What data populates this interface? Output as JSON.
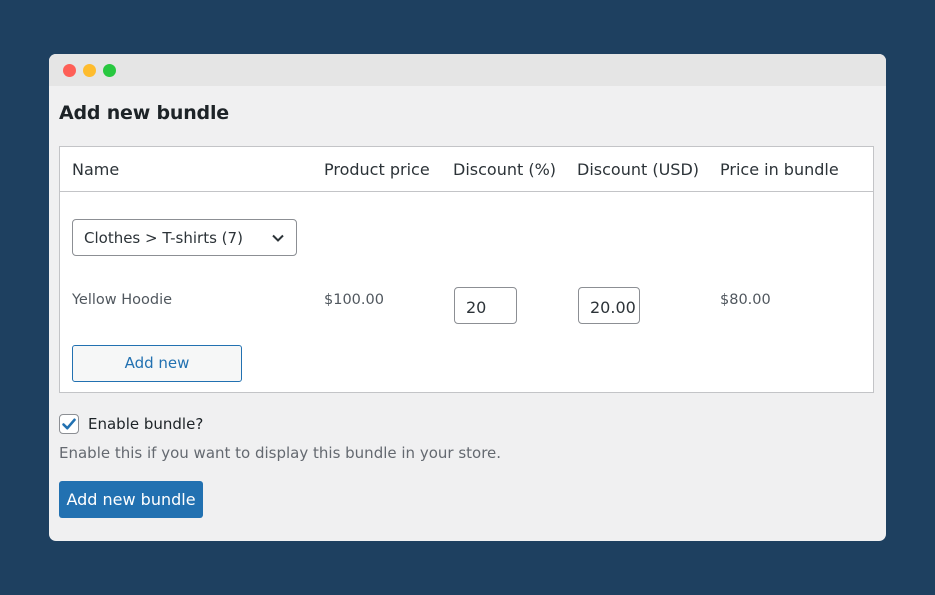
{
  "window": {
    "controls": [
      "close",
      "minimize",
      "maximize"
    ]
  },
  "page": {
    "title": "Add new bundle"
  },
  "table": {
    "headers": [
      "Name",
      "Product price",
      "Discount (%)",
      "Discount (USD)",
      "Price in bundle"
    ],
    "category_select": {
      "value": "Clothes > T-shirts (7)",
      "icon": "chevron-down-icon"
    },
    "rows": [
      {
        "name": "Yellow Hoodie",
        "product_price": "$100.00",
        "discount_percent": "20",
        "discount_usd": "20.00",
        "price_in_bundle": "$80.00"
      }
    ],
    "add_new_label": "Add new"
  },
  "enable": {
    "checked": true,
    "label": "Enable bundle?",
    "help": "Enable this if you want to display this bundle in your store."
  },
  "submit": {
    "label": "Add new bundle"
  },
  "colors": {
    "background": "#1e4060",
    "accent": "#2271b1",
    "panel": "#f0f0f1"
  }
}
